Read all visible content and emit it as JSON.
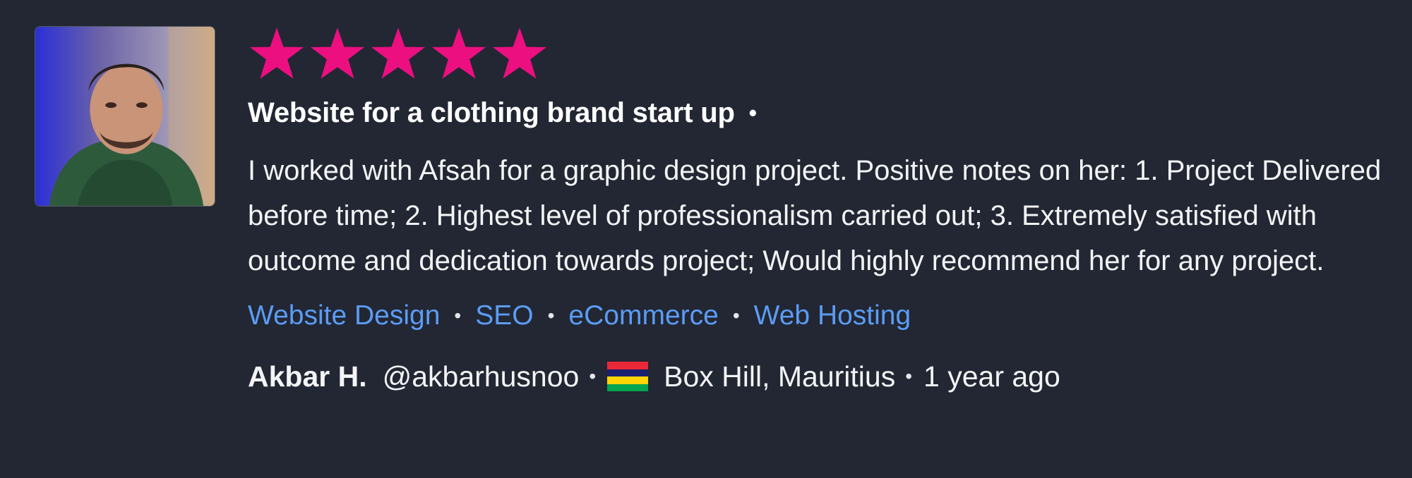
{
  "review": {
    "rating": 5,
    "rating_max": 5,
    "title": "Website for a clothing brand start up",
    "title_separator": "•",
    "body": "I worked with Afsah for a graphic design project. Positive notes on her: 1. Project Delivered before time; 2. Highest level of professionalism carried out; 3. Extremely satisfied with outcome and dedication towards project; Would highly recommend her for any project.",
    "tags": [
      "Website Design",
      "SEO",
      "eCommerce",
      "Web Hosting"
    ],
    "separator": "•",
    "reviewer": {
      "name": "Akbar H.",
      "handle": "@akbarhusnoo",
      "location": "Box Hill, Mauritius",
      "time_ago": "1 year ago",
      "flag_colors": [
        "#ea2839",
        "#1a206d",
        "#ffd500",
        "#00a551"
      ]
    }
  },
  "colors": {
    "background": "#222733",
    "star": "#ec0f80",
    "tag_link": "#5b9cf4",
    "text": "#ffffff"
  },
  "icons": {
    "star": "star-icon",
    "flag": "mauritius-flag-icon"
  }
}
